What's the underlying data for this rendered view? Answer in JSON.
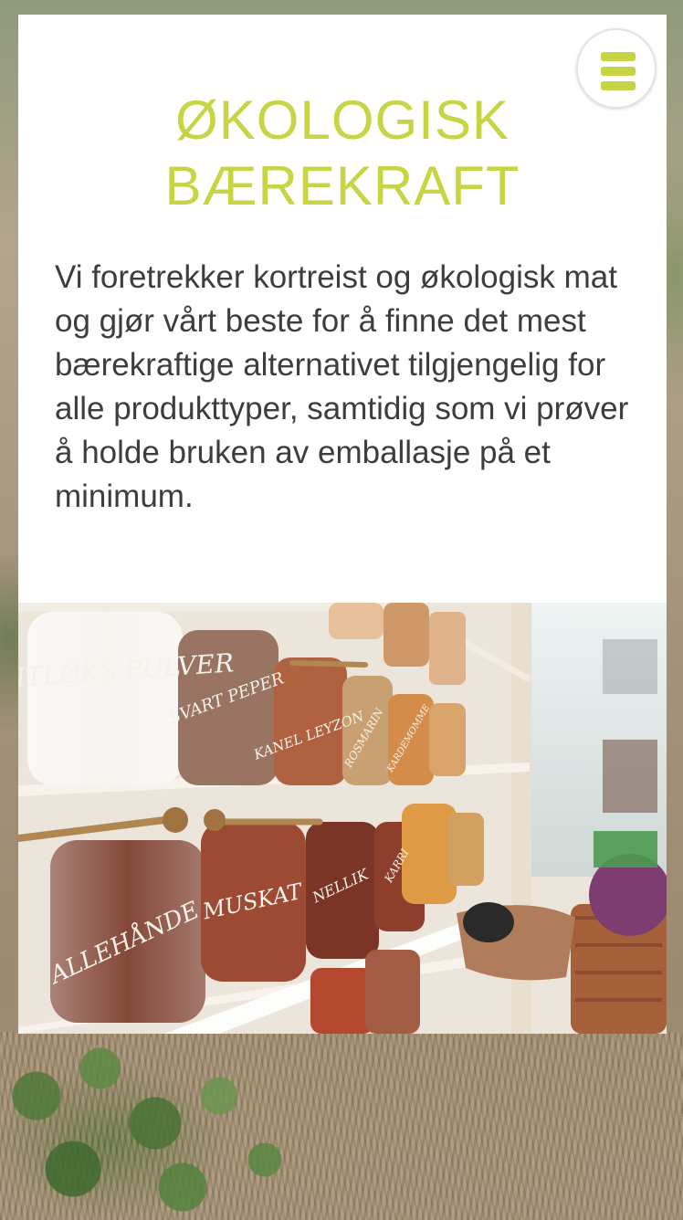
{
  "section": {
    "title_line1": "ØKOLOGISK",
    "title_line2": "BÆREKRAFT",
    "body": "Vi foretrekker kortreist og økologisk mat og gjør vårt beste for å finne det mest bærekraftige alternativet tilgjengelig for alle produkttyper, samtidig som vi prøver å holde bruken av emballasje på et minimum."
  },
  "menu": {
    "icon": "hamburger-menu-icon"
  },
  "photo": {
    "jar_labels": [
      "HVITLØKS PULVER",
      "SVART PEPER",
      "KANEL LEYZON",
      "ROSMARIN",
      "KARDEMOMME",
      "ALLEHÅNDE",
      "MUSKAT",
      "NELLIK",
      "KARRI"
    ]
  },
  "colors": {
    "accent": "#c7d545",
    "text": "#3d3d3d",
    "card": "#ffffff"
  }
}
